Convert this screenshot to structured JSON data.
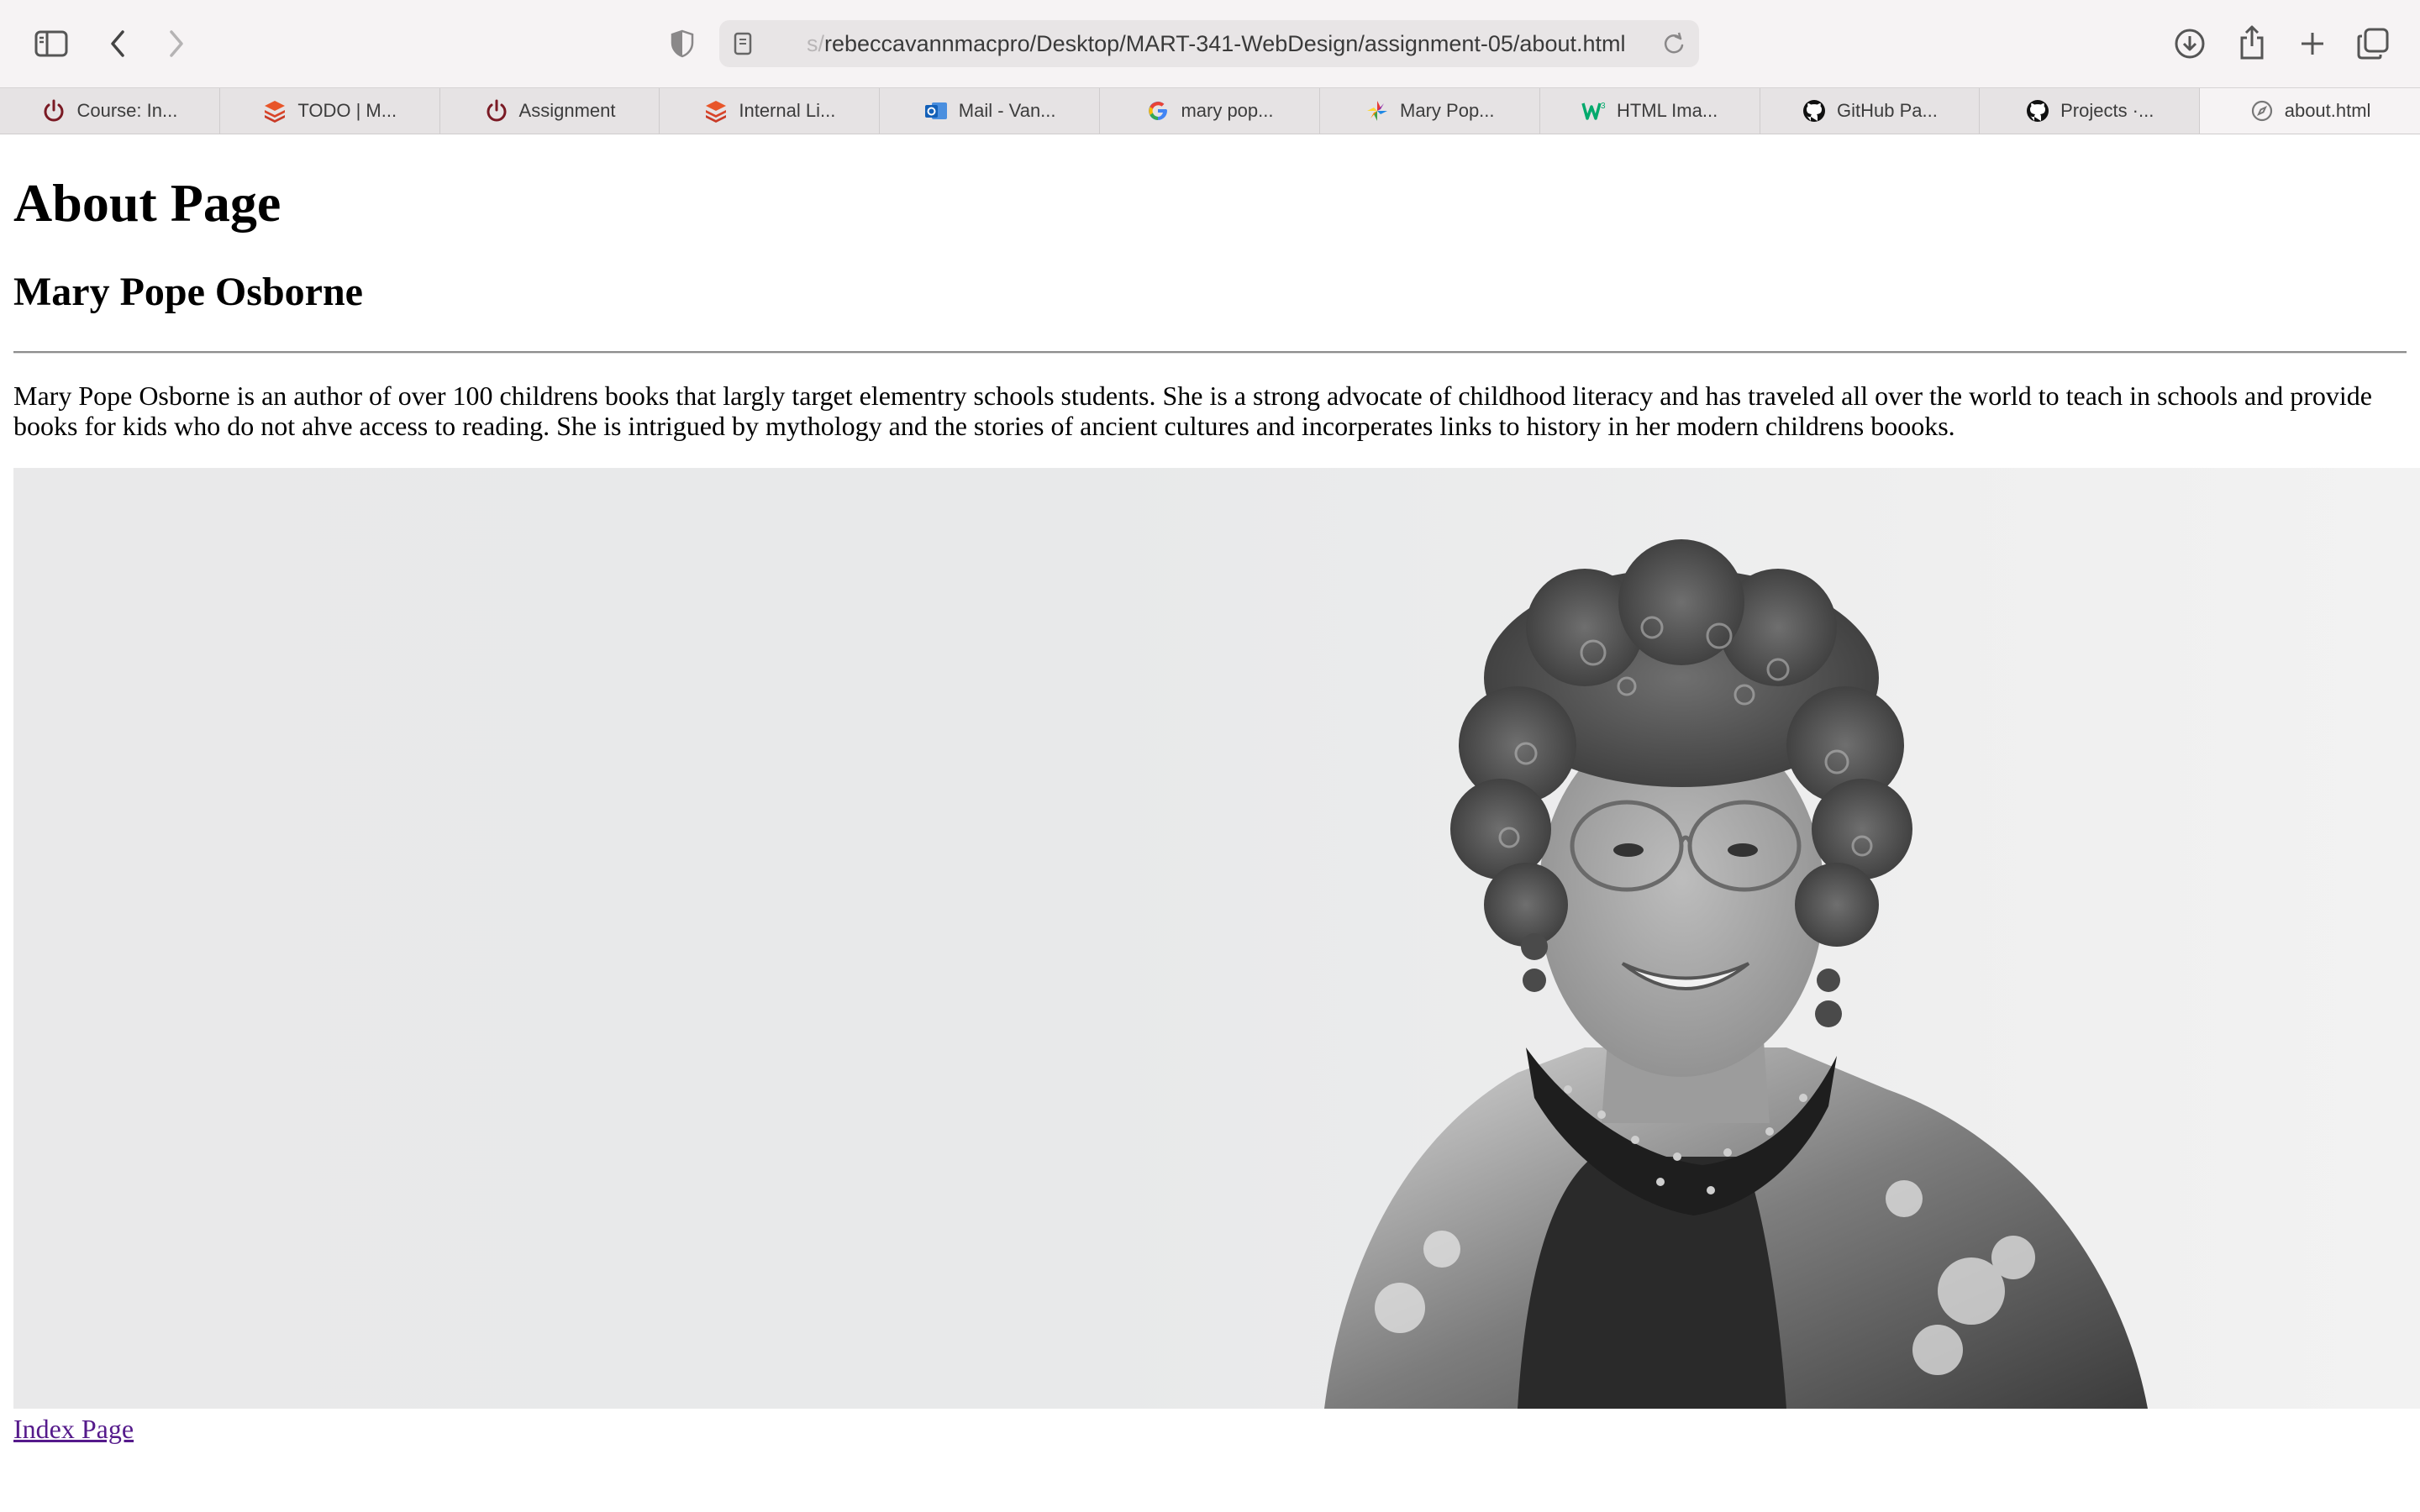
{
  "browser": {
    "url_prefix": "s/",
    "url": "rebeccavannmacpro/Desktop/MART-341-WebDesign/assignment-05/about.html",
    "tabs": [
      {
        "label": "Course: In...",
        "icon": "power-icon"
      },
      {
        "label": "TODO | M...",
        "icon": "stack-icon"
      },
      {
        "label": "Assignment",
        "icon": "power-icon"
      },
      {
        "label": "Internal Li...",
        "icon": "stack-icon"
      },
      {
        "label": "Mail - Van...",
        "icon": "outlook-icon"
      },
      {
        "label": "mary pop...",
        "icon": "google-icon"
      },
      {
        "label": "Mary Pop...",
        "icon": "pinwheel-icon"
      },
      {
        "label": "HTML Ima...",
        "icon": "w3-icon"
      },
      {
        "label": "GitHub Pa...",
        "icon": "github-icon"
      },
      {
        "label": "Projects ·...",
        "icon": "github-icon"
      }
    ],
    "active_tab": {
      "label": "about.html",
      "icon": "compass-icon"
    }
  },
  "page": {
    "title": "About Page",
    "subtitle": "Mary Pope Osborne",
    "bio": "Mary Pope Osborne is an author of over 100 childrens books that largly target elementry schools students. She is a strong advocate of childhood literacy and has traveled all over the world to teach in schools and provide books for kids who do not ahve access to reading. She is intrigued by mythology and the stories of ancient cultures and incorperates links to history in her modern childrens boooks.",
    "link_label": "Index Page"
  },
  "colors": {
    "link_visited": "#551a8b",
    "chrome_bg": "#f6f3f4",
    "tabbar_bg": "#e6e3e4"
  }
}
